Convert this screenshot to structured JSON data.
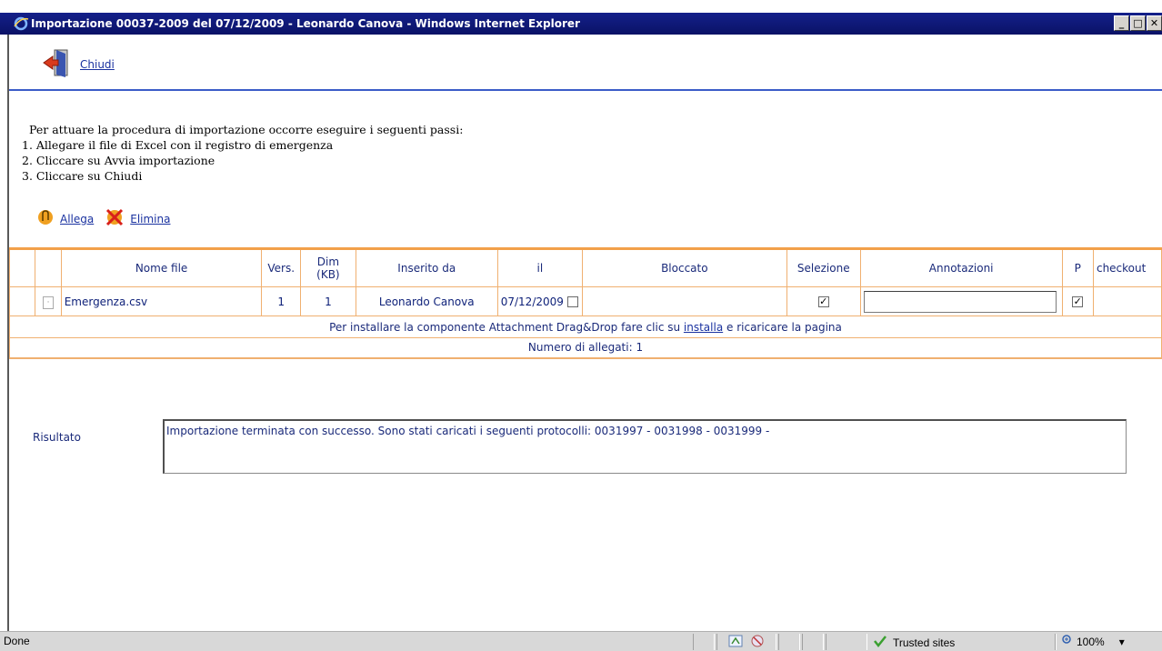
{
  "window": {
    "title": "Importazione  00037-2009 del 07/12/2009  -  Leonardo Canova - Windows Internet Explorer",
    "buttons": [
      "_",
      "□",
      "✕"
    ]
  },
  "toolbar": {
    "close_label": "Chiudi"
  },
  "instructions": {
    "intro": "Per attuare la procedura di importazione occorre eseguire i seguenti passi:",
    "steps": [
      "1. Allegare il file di Excel con il registro di emergenza",
      "2. Cliccare su Avvia importazione",
      "3. Cliccare su Chiudi"
    ]
  },
  "actions": {
    "attach_label": "Allega",
    "delete_label": "Elimina"
  },
  "table": {
    "headers": {
      "filename": "Nome file",
      "version": "Vers.",
      "size_line1": "Dim",
      "size_line2": "(KB)",
      "inserted_by": "Inserito da",
      "date": "il",
      "locked": "Bloccato",
      "selection": "Selezione",
      "notes": "Annotazioni",
      "p": "P",
      "checkout": "checkout"
    },
    "rows": [
      {
        "filename": "Emergenza.csv",
        "version": "1",
        "size": "1",
        "inserted_by": "Leonardo Canova",
        "date": "07/12/2009",
        "locked": false,
        "selected": true,
        "notes": "",
        "p": true,
        "checkout": ""
      }
    ],
    "install_text_before": "Per installare la componente Attachment Drag&Drop fare clic su ",
    "install_link": "installa",
    "install_text_after": " e ricaricare la pagina",
    "count_text": "Numero di allegati: 1"
  },
  "result": {
    "label": "Risultato",
    "text": "Importazione terminata con successo. Sono stati caricati i seguenti protocolli: 0031997 - 0031998 - 0031999 -"
  },
  "status": {
    "left": "Done",
    "zone": "Trusted sites",
    "zoom": "100%",
    "zoom_arrow": "▾"
  },
  "colors": {
    "title_bar": "#0a1266",
    "link": "#1a32a0",
    "table_border": "#f0b070",
    "table_header_accent": "#f2a04a",
    "text_blue": "#1a2a7a"
  }
}
